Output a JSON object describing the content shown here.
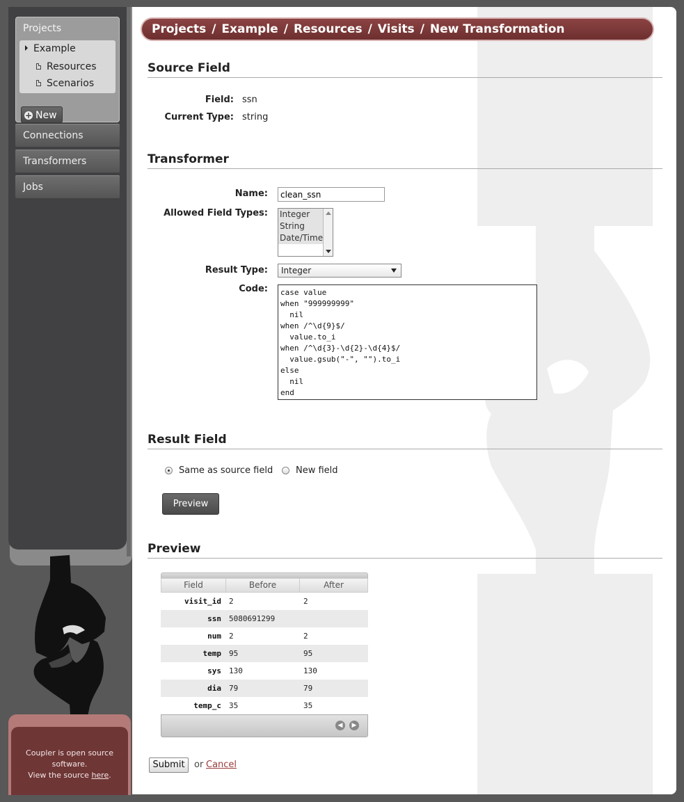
{
  "sidebar": {
    "projects_title": "Projects",
    "project_items": [
      {
        "label": "Example",
        "icon": "triangle-right-icon"
      },
      {
        "label": "Resources",
        "icon": "document-icon"
      },
      {
        "label": "Scenarios",
        "icon": "document-icon"
      }
    ],
    "new_button": "New",
    "nav": [
      "Connections",
      "Transformers",
      "Jobs"
    ]
  },
  "footer": {
    "line1": "Coupler is open source",
    "line2": "software.",
    "line3_prefix": "View the source",
    "link": "here",
    "line3_suffix": "."
  },
  "breadcrumb": [
    "Projects",
    "Example",
    "Resources",
    "Visits",
    "New Transformation"
  ],
  "breadcrumb_separator": "/",
  "source_field": {
    "title": "Source Field",
    "field_label": "Field:",
    "field_value": "ssn",
    "type_label": "Current Type:",
    "type_value": "string"
  },
  "transformer": {
    "title": "Transformer",
    "name_label": "Name:",
    "name_value": "clean_ssn",
    "allowed_label": "Allowed Field Types:",
    "allowed_options": [
      "Integer",
      "String",
      "Date/Time"
    ],
    "result_label": "Result Type:",
    "result_value": "Integer",
    "code_label": "Code:",
    "code_value": "case value\nwhen \"999999999\"\n  nil\nwhen /^\\d{9}$/\n  value.to_i\nwhen /^\\d{3}-\\d{2}-\\d{4}$/\n  value.gsub(\"-\", \"\").to_i\nelse\n  nil\nend"
  },
  "result_field": {
    "title": "Result Field",
    "option_same": "Same as source field",
    "option_new": "New field",
    "preview_button": "Preview"
  },
  "preview": {
    "title": "Preview",
    "columns": [
      "Field",
      "Before",
      "After"
    ],
    "rows": [
      {
        "field": "visit_id",
        "before": "2",
        "after": "2"
      },
      {
        "field": "ssn",
        "before": "5080691299",
        "after": ""
      },
      {
        "field": "num",
        "before": "2",
        "after": "2"
      },
      {
        "field": "temp",
        "before": "95",
        "after": "95"
      },
      {
        "field": "sys",
        "before": "130",
        "after": "130"
      },
      {
        "field": "dia",
        "before": "79",
        "after": "79"
      },
      {
        "field": "temp_c",
        "before": "35",
        "after": "35"
      }
    ]
  },
  "form": {
    "submit": "Submit",
    "or": "or",
    "cancel": "Cancel"
  },
  "colors": {
    "breadcrumb_bg": "#7a3838",
    "sidebar_bg": "#414042",
    "footer_bg": "#6f3636",
    "page_bg": "#585858"
  }
}
